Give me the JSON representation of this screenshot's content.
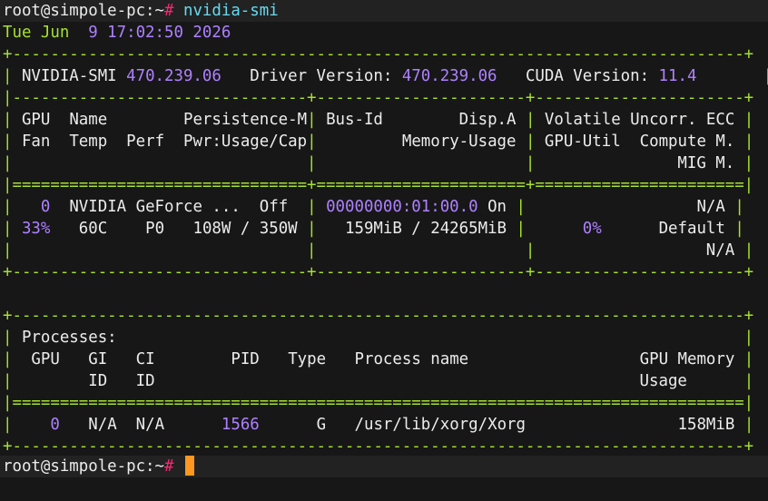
{
  "colors": {
    "background": "#171717",
    "prompt_band": "#222222",
    "text": "#ececec",
    "table_border": "#a6e22e",
    "number": "#ae81ff",
    "prompt_hash": "#f92672",
    "command": "#66d9ef",
    "cursor": "#fd971f"
  },
  "prompt": {
    "user_host": "root@simpole-pc:~",
    "symbol": "#",
    "command": "nvidia-smi"
  },
  "timestamp": {
    "day_month": "Tue Jun  ",
    "rest": "9 17:02:50 2026"
  },
  "gpu_table": {
    "border_top": "+-----------------------------------------------------------------------------+",
    "smi_label": "NVIDIA-SMI",
    "smi_version": "470.239.06",
    "driver_label": "Driver Version:",
    "driver_version": "470.239.06",
    "cuda_label": "CUDA Version:",
    "cuda_version": "11.4",
    "divider": "|-------------------------------+----------------------+----------------------+",
    "header_row1": [
      "GPU",
      "Name",
      "Persistence-M",
      "Bus-Id",
      "Disp.A",
      "Volatile Uncorr. ECC"
    ],
    "header_row2": [
      "Fan",
      "Temp",
      "Perf",
      "Pwr:Usage/Cap",
      "Memory-Usage",
      "GPU-Util",
      "Compute M."
    ],
    "header_row3": [
      "MIG M."
    ],
    "double_divider": "|===============================+======================+======================|",
    "gpu": {
      "index": "0",
      "name": "NVIDIA GeForce ...",
      "persistence": "Off",
      "bus_id": "00000000:01:00.0",
      "disp_a": "On",
      "ecc": "N/A",
      "fan": "33%",
      "temp": "60C",
      "perf": "P0",
      "power": "108W / 350W",
      "memory": "159MiB / 24265MiB",
      "gpu_util": "0%",
      "compute_mode": "Default",
      "mig_mode": "N/A"
    },
    "border_bottom": "+-------------------------------+----------------------+----------------------+"
  },
  "process_table": {
    "title": "Processes:",
    "headers_row1": [
      "GPU",
      "GI",
      "CI",
      "PID",
      "Type",
      "Process name",
      "GPU Memory"
    ],
    "headers_row2": [
      "ID",
      "ID",
      "Usage"
    ],
    "processes": [
      {
        "gpu": "0",
        "gi": "N/A",
        "ci": "N/A",
        "pid": "1566",
        "type": "G",
        "name": "/usr/lib/xorg/Xorg",
        "memory": "158MiB"
      }
    ]
  }
}
